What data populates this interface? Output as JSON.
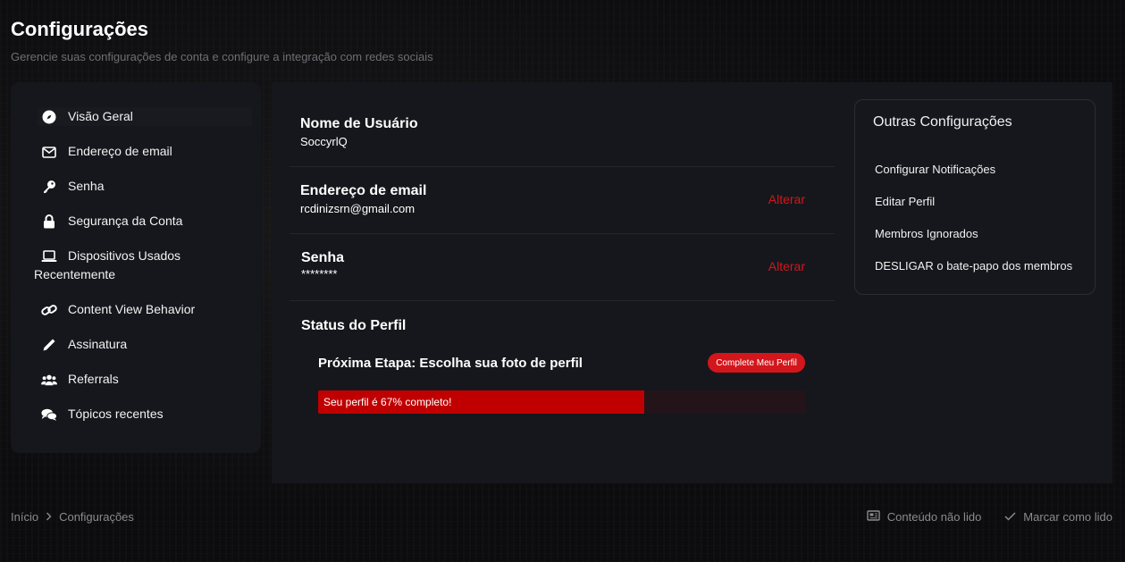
{
  "page": {
    "title": "Configurações",
    "subtitle": "Gerencie suas configurações de conta e configure a integração com redes sociais"
  },
  "sidebar": {
    "items": [
      {
        "label": "Visão Geral",
        "icon": "compass-icon"
      },
      {
        "label": "Endereço de email",
        "icon": "envelope-icon"
      },
      {
        "label": "Senha",
        "icon": "key-icon"
      },
      {
        "label": "Segurança da Conta",
        "icon": "lock-icon"
      },
      {
        "label_line1": "Dispositivos Usados",
        "label_line2": "Recentemente",
        "icon": "laptop-icon"
      },
      {
        "label": "Content View Behavior",
        "icon": "link-icon"
      },
      {
        "label": "Assinatura",
        "icon": "pencil-icon"
      },
      {
        "label": "Referrals",
        "icon": "users-icon"
      },
      {
        "label": "Tópicos recentes",
        "icon": "comments-icon"
      }
    ]
  },
  "account": {
    "username": {
      "title": "Nome de Usuário",
      "value": "SoccyrlQ"
    },
    "email": {
      "title": "Endereço de email",
      "value": "rcdinizsrn@gmail.com",
      "action": "Alterar"
    },
    "password": {
      "title": "Senha",
      "value": "********",
      "action": "Alterar"
    }
  },
  "profile_status": {
    "title": "Status do Perfil",
    "next_step": "Próxima Etapa: Escolha sua foto de perfil",
    "button": "Complete Meu Perfil",
    "progress_text": "Seu perfil é 67% completo!",
    "progress_percent": 67
  },
  "other_settings": {
    "title": "Outras Configurações",
    "links": [
      "Configurar Notificações",
      "Editar Perfil",
      "Membros Ignorados",
      "DESLIGAR o bate-papo dos membros"
    ]
  },
  "breadcrumb": {
    "home": "Início",
    "current": "Configurações"
  },
  "footer": {
    "unread": "Conteúdo não lido",
    "mark_read": "Marcar como lido"
  },
  "colors": {
    "accent": "#d3161b",
    "progress": "#c00000",
    "panel": "#16171c",
    "background": "#0c0c0e"
  }
}
